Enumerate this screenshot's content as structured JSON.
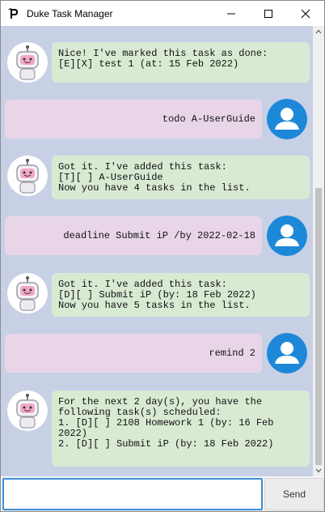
{
  "window": {
    "title": "Duke Task Manager",
    "icon": "duke-logo-icon",
    "controls": [
      "minimize-icon",
      "maximize-icon",
      "close-icon"
    ]
  },
  "messages": [
    {
      "sender": "duke",
      "text": "Nice! I've marked this task as done:\n[E][X] test 1 (at: 15 Feb 2022)"
    },
    {
      "sender": "user",
      "text": "todo A-UserGuide"
    },
    {
      "sender": "duke",
      "text": "Got it. I've added this task:\n[T][ ] A-UserGuide\nNow you have 4 tasks in the list."
    },
    {
      "sender": "user",
      "text": "deadline Submit iP /by 2022-02-18"
    },
    {
      "sender": "duke",
      "text": "Got it. I've added this task:\n[D][ ] Submit iP (by: 18 Feb 2022)\nNow you have 5 tasks in the list."
    },
    {
      "sender": "user",
      "text": "remind 2"
    },
    {
      "sender": "duke",
      "text": "For the next 2 day(s), you have the\nfollowing task(s) scheduled:\n1. [D][ ] 2108 Homework 1 (by: 16 Feb\n2022)\n2. [D][ ] Submit iP (by: 18 Feb 2022)"
    }
  ],
  "input": {
    "value": "",
    "placeholder": ""
  },
  "send_button": {
    "label": "Send"
  },
  "colors": {
    "chat_background": "#c8d0e6",
    "duke_bubble": "#d9ead3",
    "user_bubble": "#e8d6e8",
    "user_avatar": "#1e88d8",
    "input_focus": "#3a8fd6"
  }
}
